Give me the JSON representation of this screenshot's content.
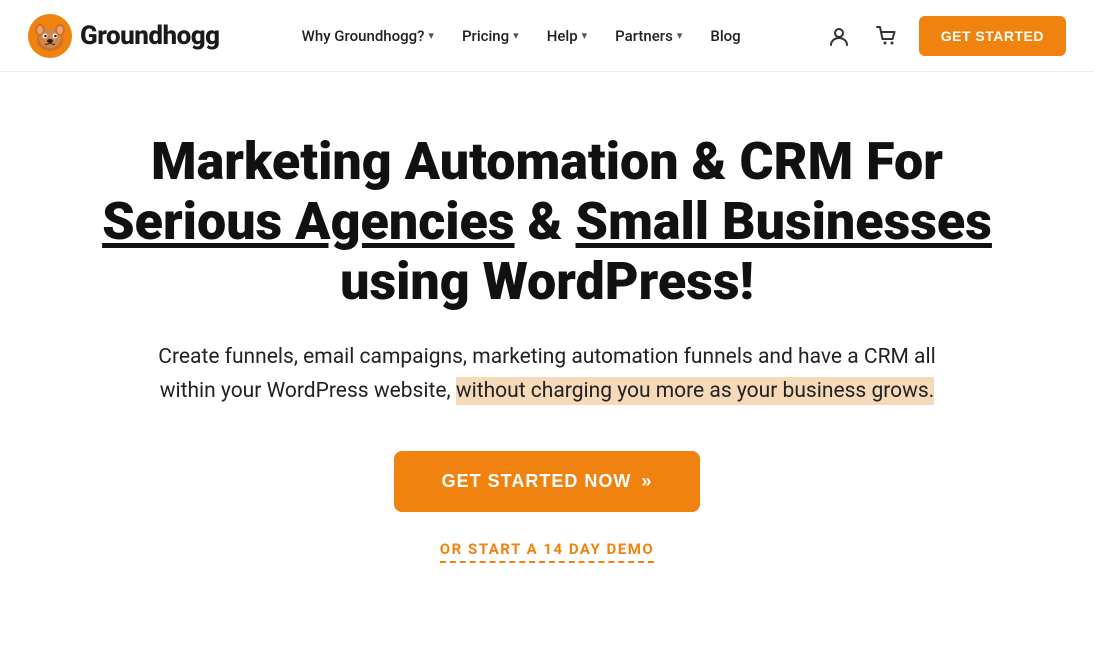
{
  "brand": {
    "logo_text": "Groundhogg",
    "logo_icon_label": "groundhogg-logo"
  },
  "navbar": {
    "items": [
      {
        "label": "Why Groundhogg?",
        "has_dropdown": true
      },
      {
        "label": "Pricing",
        "has_dropdown": true
      },
      {
        "label": "Help",
        "has_dropdown": true
      },
      {
        "label": "Partners",
        "has_dropdown": true
      },
      {
        "label": "Blog",
        "has_dropdown": false
      }
    ],
    "cta_label": "GET STARTED"
  },
  "hero": {
    "title_part1": "Marketing Automation & CRM For ",
    "title_underline1": "Serious Agencies",
    "title_part2": " & ",
    "title_underline2": "Small Businesses",
    "title_part3": " using WordPress!",
    "subtitle_part1": "Create funnels, email campaigns, marketing automation funnels and have a CRM all within your WordPress website, ",
    "subtitle_highlight": "without charging you more as your business grows.",
    "cta_primary": "GET STARTED NOW",
    "cta_chevrons": "»",
    "cta_secondary": "OR START A 14 DAY DEMO"
  }
}
